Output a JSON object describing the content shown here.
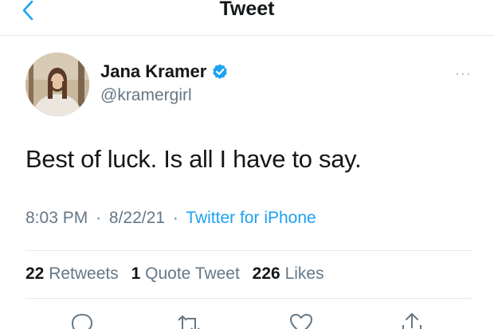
{
  "header": {
    "title": "Tweet",
    "back_icon": "chevron-left-icon"
  },
  "tweet": {
    "author": {
      "display_name": "Jana Kramer",
      "handle": "@kramergirl",
      "verified": true
    },
    "text": "Best of luck. Is all I have to say.",
    "time": "8:03 PM",
    "date": "8/22/21",
    "separator": "·",
    "source": "Twitter for iPhone",
    "more_label": "···"
  },
  "stats": {
    "retweets_count": "22",
    "retweets_label": "Retweets",
    "quotes_count": "1",
    "quotes_label": "Quote Tweet",
    "likes_count": "226",
    "likes_label": "Likes"
  },
  "actions": {
    "icons": [
      "reply-icon",
      "retweet-icon",
      "like-icon",
      "share-icon"
    ]
  },
  "colors": {
    "accent": "#1da1f2",
    "secondary_text": "#657786",
    "primary_text": "#14171a",
    "divider": "#e1e8ed"
  }
}
